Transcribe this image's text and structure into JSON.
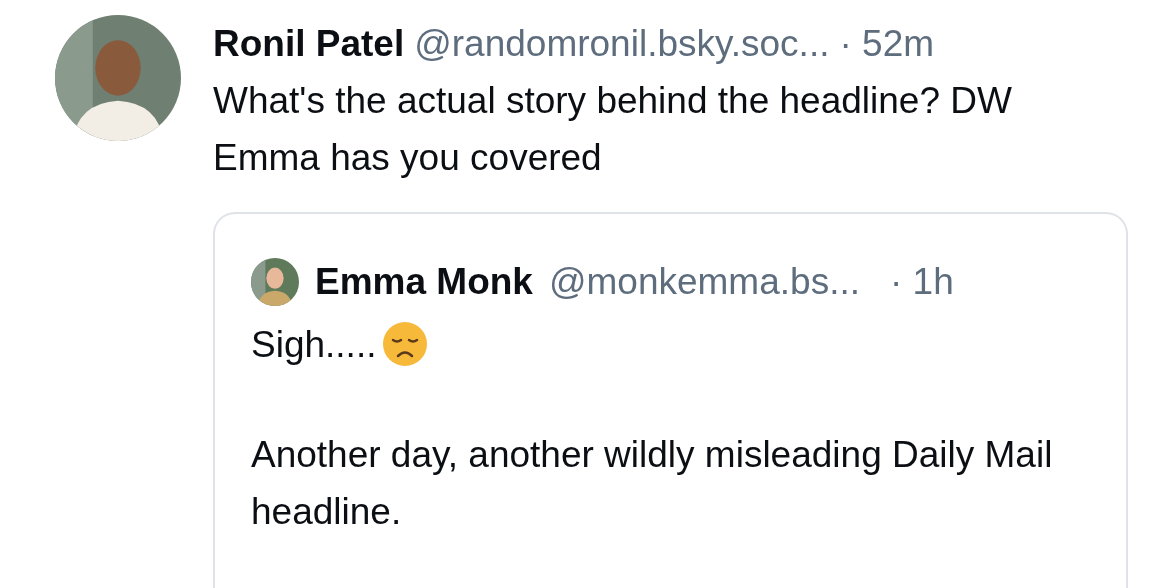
{
  "post": {
    "author": "Ronil Patel",
    "handle": "@randomronil.bsky.soc...",
    "time": "· 52m",
    "text": "What's the actual story behind the headline? DW Emma has you covered",
    "quote": {
      "author": "Emma Monk",
      "handle": "@monkemma.bs...",
      "time": "· 1h",
      "first_line": "Sigh.....",
      "paragraph": "Another day, another wildly misleading Daily Mail headline."
    }
  }
}
